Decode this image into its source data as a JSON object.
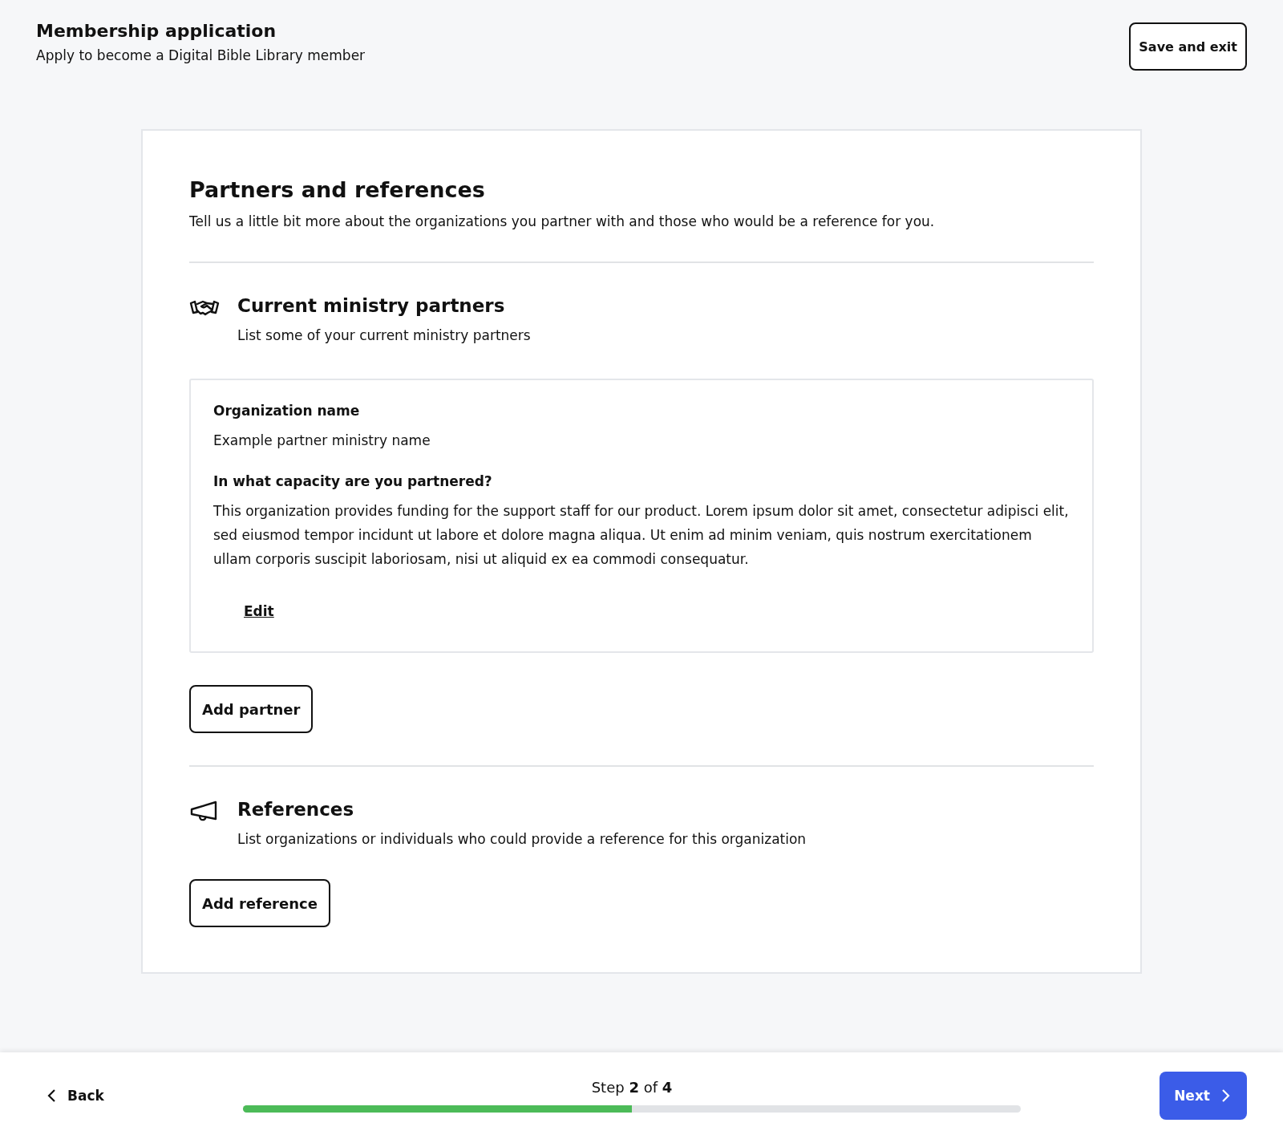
{
  "header": {
    "title": "Membership application",
    "subtitle": "Apply to become a Digital Bible Library member",
    "save_button": "Save and exit"
  },
  "page": {
    "title": "Partners and references",
    "description": "Tell us a little bit more about the organizations you partner with and those who would be a reference for you."
  },
  "sections": [
    {
      "kind": "partners",
      "title": "Current ministry partners",
      "description": "List some of your current ministry partners",
      "entries": [
        {
          "fields": [
            {
              "label": "Organization name",
              "value": "Example partner ministry name"
            },
            {
              "label": "In what capacity are you partnered?",
              "value": "This organization provides funding for the support staff for our product. Lorem ipsum dolor sit amet, consectetur adipisci elit, sed eiusmod tempor incidunt ut labore et dolore magna aliqua. Ut enim ad minim veniam, quis nostrum exercitationem ullam corporis suscipit laboriosam, nisi ut aliquid ex ea commodi consequatur."
            }
          ],
          "edit_link": "Edit"
        }
      ],
      "add_button": "Add partner"
    },
    {
      "kind": "references",
      "title": "References",
      "description": "List organizations or individuals who could provide a reference for this organization",
      "add_button": "Add reference"
    }
  ],
  "footer": {
    "back": "Back",
    "step": "Step **2** of **4**",
    "progress": {
      "level": 0.5
    },
    "next": "Next"
  }
}
